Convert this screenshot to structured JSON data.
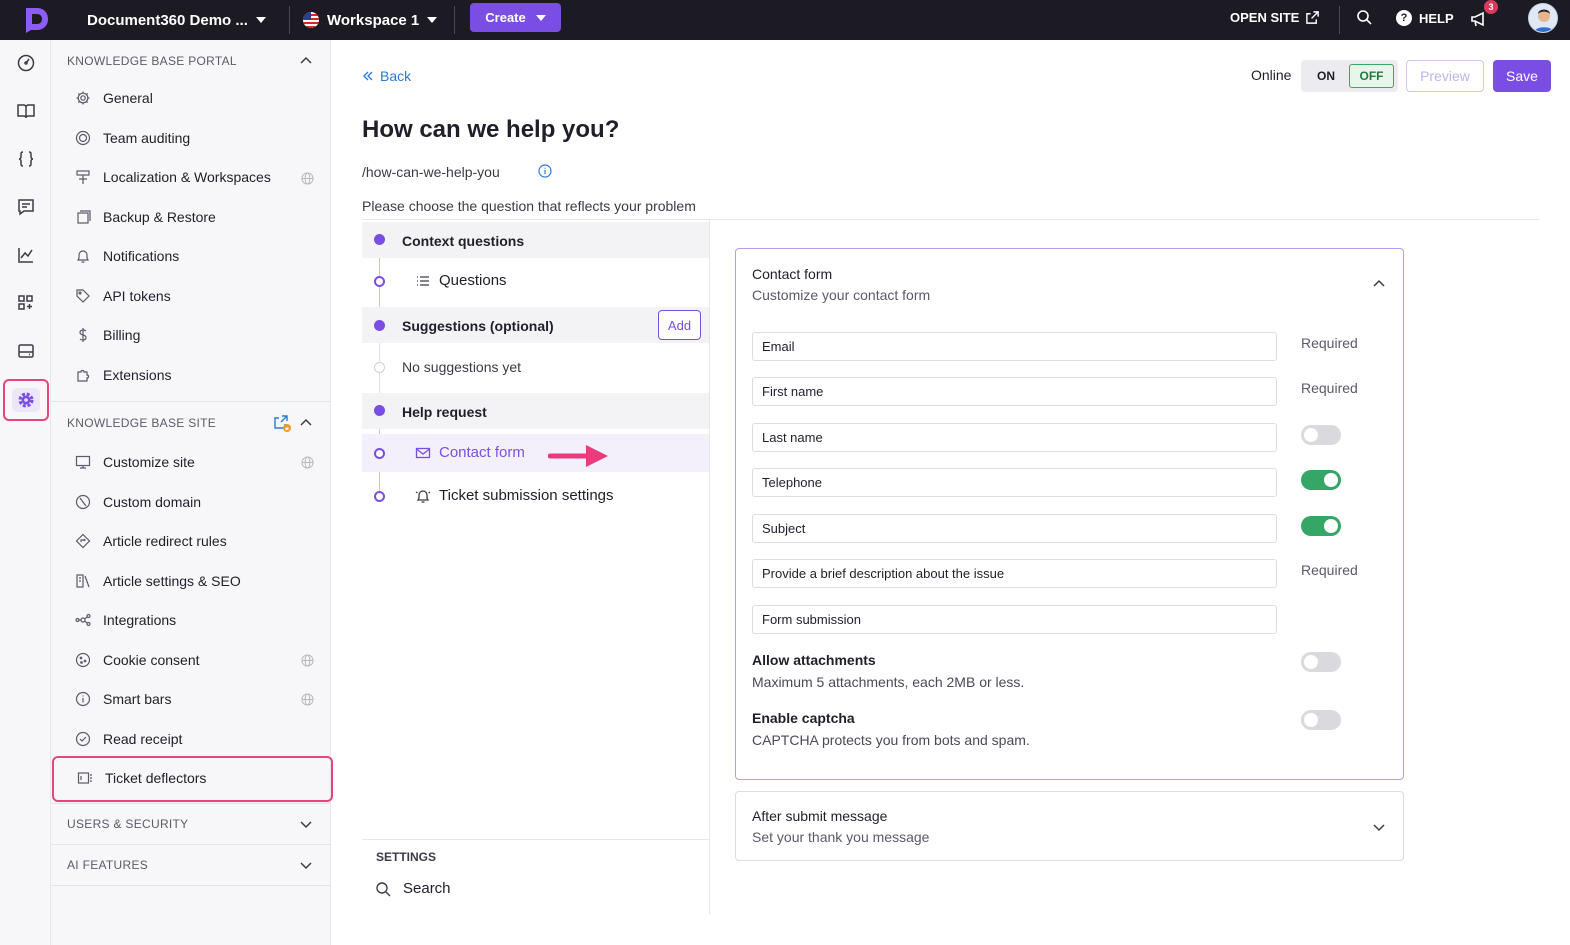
{
  "topbar": {
    "project_name": "Document360 Demo ...",
    "workspace": "Workspace 1",
    "create_label": "Create",
    "open_site_label": "OPEN SITE",
    "help_label": "HELP",
    "notification_count": "3",
    "icons": [
      "logo-icon",
      "external-link-icon",
      "search-icon",
      "help-icon",
      "megaphone-icon",
      "avatar"
    ]
  },
  "rail": {
    "items": [
      "dashboard-icon",
      "book-icon",
      "code-braces-icon",
      "chat-icon",
      "analytics-icon",
      "apps-icon",
      "drive-icon",
      "settings-icon"
    ],
    "active": "settings-icon"
  },
  "sidebar": {
    "portal_header": "KNOWLEDGE BASE PORTAL",
    "portal_items": [
      {
        "label": "General",
        "icon": "gear-icon"
      },
      {
        "label": "Team auditing",
        "icon": "audit-icon"
      },
      {
        "label": "Localization & Workspaces",
        "icon": "localization-icon",
        "globe": true
      },
      {
        "label": "Backup & Restore",
        "icon": "backup-icon"
      },
      {
        "label": "Notifications",
        "icon": "bell-icon"
      },
      {
        "label": "API tokens",
        "icon": "tag-icon"
      },
      {
        "label": "Billing",
        "icon": "dollar-icon"
      },
      {
        "label": "Extensions",
        "icon": "puzzle-icon"
      }
    ],
    "site_header": "KNOWLEDGE BASE SITE",
    "site_items": [
      {
        "label": "Customize site",
        "icon": "monitor-icon",
        "globe": true
      },
      {
        "label": "Custom domain",
        "icon": "domain-icon"
      },
      {
        "label": "Article redirect rules",
        "icon": "redirect-icon"
      },
      {
        "label": "Article settings & SEO",
        "icon": "seo-icon"
      },
      {
        "label": "Integrations",
        "icon": "integrations-icon"
      },
      {
        "label": "Cookie consent",
        "icon": "cookie-icon",
        "globe": true
      },
      {
        "label": "Smart bars",
        "icon": "info-icon",
        "globe": true
      },
      {
        "label": "Read receipt",
        "icon": "check-circle-icon"
      },
      {
        "label": "Ticket deflectors",
        "icon": "ticket-icon"
      }
    ],
    "users_header": "USERS & SECURITY",
    "ai_header": "AI FEATURES"
  },
  "main": {
    "back_label": "Back",
    "online_label": "Online",
    "on_label": "ON",
    "off_label": "OFF",
    "preview_label": "Preview",
    "save_label": "Save",
    "title": "How can we help you?",
    "slug": "/how-can-we-help-you",
    "instruction": "Please choose the question that reflects your problem"
  },
  "steps": {
    "context_header": "Context questions",
    "questions_label": "Questions",
    "suggestions_header": "Suggestions (optional)",
    "add_label": "Add",
    "no_suggestions": "No suggestions yet",
    "help_header": "Help request",
    "contact_form_label": "Contact form",
    "ticket_settings_label": "Ticket submission settings",
    "settings_header": "SETTINGS",
    "search_label": "Search"
  },
  "contact_form": {
    "title": "Contact form",
    "subtitle": "Customize your contact form",
    "fields": [
      {
        "label": "Email",
        "status": "Required"
      },
      {
        "label": "First name",
        "status": "Required"
      },
      {
        "label": "Last name",
        "status": "toggle-off"
      },
      {
        "label": "Telephone",
        "status": "toggle-on"
      },
      {
        "label": "Subject",
        "status": "toggle-on"
      },
      {
        "label": "Provide a brief description about the issue",
        "status": "Required"
      },
      {
        "label": "Form submission",
        "status": ""
      }
    ],
    "allow_attachments_title": "Allow attachments",
    "allow_attachments_sub": "Maximum 5 attachments, each 2MB or less.",
    "allow_attachments_enabled": false,
    "captcha_title": "Enable captcha",
    "captcha_sub": "CAPTCHA protects you from bots and spam.",
    "captcha_enabled": false
  },
  "after_submit": {
    "title": "After submit message",
    "subtitle": "Set your thank you message"
  },
  "colors": {
    "accent": "#7a4ee3",
    "toggle_on": "#35a665",
    "highlight": "#e6457c",
    "topbar": "#1c1b24"
  }
}
